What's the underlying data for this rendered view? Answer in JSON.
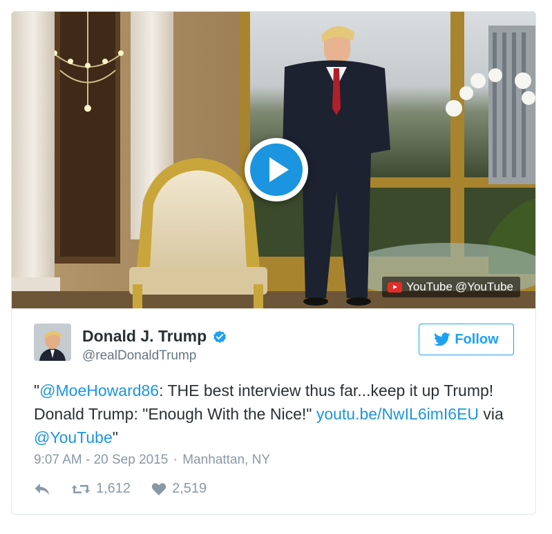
{
  "media": {
    "source_name": "YouTube",
    "source_handle": "@YouTube"
  },
  "author": {
    "name": "Donald J. Trump",
    "handle": "@realDonaldTrump",
    "verified": true
  },
  "follow_label": "Follow",
  "tweet": {
    "quote_open": "\"",
    "mention": "@MoeHoward86",
    "text_part1": ": THE best interview thus far...keep it up Trump! Donald Trump: \"Enough With the Nice!\" ",
    "link": "youtu.be/NwIL6imI6EU",
    "via_text": " via ",
    "via_mention": "@YouTube",
    "quote_close": "\""
  },
  "meta": {
    "time": "9:07 AM - 20 Sep 2015",
    "separator": "·",
    "location": "Manhattan, NY"
  },
  "stats": {
    "retweets": "1,612",
    "likes": "2,519"
  },
  "colors": {
    "accent": "#1da1f2",
    "link": "#1b95e0",
    "youtube_red": "#e52d27",
    "muted": "#8899a6"
  },
  "icons": [
    "play-icon",
    "youtube-icon",
    "verified-icon",
    "twitter-bird-icon",
    "reply-icon",
    "retweet-icon",
    "heart-icon"
  ]
}
